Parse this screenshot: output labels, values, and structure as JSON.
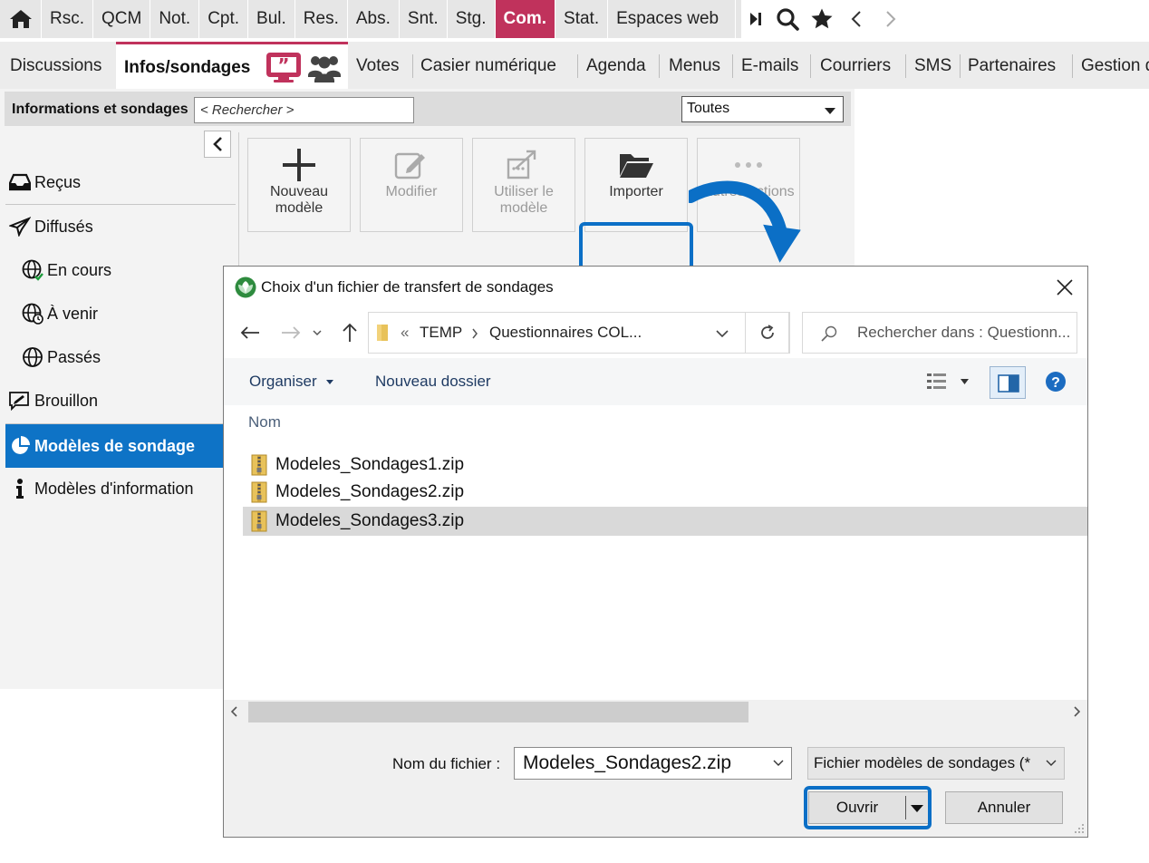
{
  "topbar": {
    "modules": [
      "Rsc.",
      "QCM",
      "Not.",
      "Cpt.",
      "Bul.",
      "Res.",
      "Abs.",
      "Snt.",
      "Stg.",
      "Com.",
      "Stat.",
      "Espaces web"
    ],
    "active_module": "Com."
  },
  "subnav": {
    "tabs": [
      "Discussions",
      "Infos/sondages",
      "Votes",
      "Casier numérique",
      "Agenda",
      "Menus",
      "E-mails",
      "Courriers",
      "SMS",
      "Partenaires",
      "Gestion d"
    ],
    "active_tab": "Infos/sondages"
  },
  "panel": {
    "title": "Informations et sondages",
    "search_placeholder": "< Rechercher >",
    "filter_value": "Toutes"
  },
  "sidebar": {
    "items": [
      {
        "label": "Reçus",
        "icon": "inbox-icon"
      },
      {
        "label": "Diffusés",
        "icon": "paper-plane-icon"
      },
      {
        "label": "En cours",
        "icon": "globe-check-icon"
      },
      {
        "label": "À venir",
        "icon": "globe-clock-icon"
      },
      {
        "label": "Passés",
        "icon": "globe-icon"
      },
      {
        "label": "Brouillon",
        "icon": "draft-icon"
      },
      {
        "label": "Modèles de sondage",
        "icon": "pie-chart-icon"
      },
      {
        "label": "Modèles d'information",
        "icon": "info-icon"
      }
    ],
    "active_item": "Modèles de sondage"
  },
  "toolbar": {
    "new_label": "Nouveau\nmodèle",
    "modify_label": "Modifier",
    "use_label": "Utiliser le\nmodèle",
    "import_label": "Importer",
    "more_label": "Autres actions"
  },
  "dialog": {
    "title": "Choix d'un fichier de transfert de sondages",
    "breadcrumb": [
      "TEMP",
      "Questionnaires COL..."
    ],
    "breadcrumb_prefix": "«",
    "search_placeholder": "Rechercher dans : Questionn...",
    "organize_label": "Organiser",
    "new_folder_label": "Nouveau dossier",
    "column_name": "Nom",
    "files": [
      "Modeles_Sondages1.zip",
      "Modeles_Sondages2.zip",
      "Modeles_Sondages3.zip"
    ],
    "selected_file": "Modeles_Sondages3.zip",
    "filename_label": "Nom du fichier :",
    "filename_value": "Modeles_Sondages2.zip",
    "filetype_value": "Fichier modèles de sondages (*",
    "open_label": "Ouvrir",
    "cancel_label": "Annuler"
  },
  "colors": {
    "accent_module": "#c0325c",
    "sidebar_active": "#0e73c6",
    "highlight": "#0b6fc6"
  }
}
